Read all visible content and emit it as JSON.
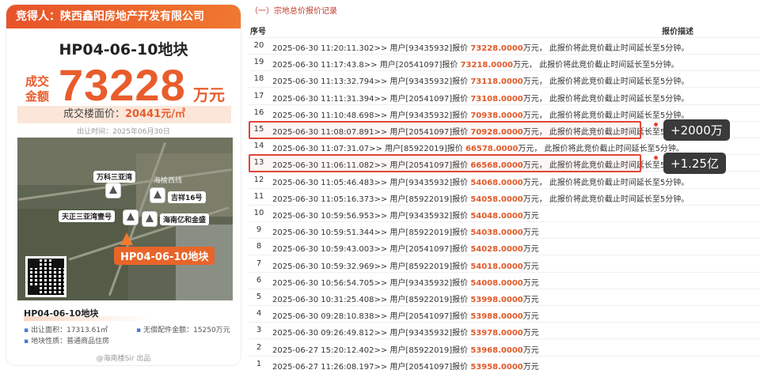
{
  "card": {
    "bidder": "竞得人：陕西鑫阳房地产开发有限公司",
    "plot_title": "HP04-06-10地块",
    "deal_label": "成交金额",
    "deal_amount": "73228",
    "deal_unit": "万元",
    "floor_price_label": "成交楼面价：",
    "floor_price_value": "20441元/㎡",
    "sale_time": "出让时间：2025年06月30日",
    "map": {
      "labels": [
        "万科三亚湾",
        "吉祥16号",
        "天正三亚湾壹号",
        "海南亿和金盛",
        "海榆西线"
      ],
      "plot_label": "HP04-06-10地块"
    },
    "info": {
      "title": "HP04-06-10地块",
      "area": "出让面积：17313.61㎡",
      "fee": "无偿配件金额：15250万元",
      "nature": "地块性质：普通商品住房"
    },
    "publisher": "@海南楼Sir 出品"
  },
  "records": {
    "section_title": "（一）宗地总价报价记录",
    "headers": {
      "no": "序号",
      "desc": "报价描述"
    },
    "rows": [
      {
        "no": "20",
        "time": "2025-06-30 11:20:11.302>>",
        "user": "用户[93435932]报价",
        "amount": "73228.0000",
        "suffix": "万元， 此报价将此竞价截止时间延长至5分钟。"
      },
      {
        "no": "19",
        "time": "2025-06-30 11:17:43.8>>",
        "user": "用户[20541097]报价",
        "amount": "73218.0000",
        "suffix": "万元， 此报价将此竞价截止时间延长至5分钟。"
      },
      {
        "no": "18",
        "time": "2025-06-30 11:13:32.794>>",
        "user": "用户[93435932]报价",
        "amount": "73118.0000",
        "suffix": "万元， 此报价将此竞价截止时间延长至5分钟。"
      },
      {
        "no": "17",
        "time": "2025-06-30 11:11:31.394>>",
        "user": "用户[20541097]报价",
        "amount": "73108.0000",
        "suffix": "万元， 此报价将此竞价截止时间延长至5分钟。"
      },
      {
        "no": "16",
        "time": "2025-06-30 11:10:48.698>>",
        "user": "用户[93435932]报价",
        "amount": "70938.0000",
        "suffix": "万元， 此报价将此竞价截止时间延长至5分钟。"
      },
      {
        "no": "15",
        "time": "2025-06-30 11:08:07.891>>",
        "user": "用户[20541097]报价",
        "amount": "70928.0000",
        "suffix": "万元， 此报价将此竞价截止时间延长至5分钟。"
      },
      {
        "no": "14",
        "time": "2025-06-30 11:07:31.07>>",
        "user": "用户[85922019]报价",
        "amount": "66578.0000",
        "suffix": "万元， 此报价将此竞价截止时间延长至5分钟。"
      },
      {
        "no": "13",
        "time": "2025-06-30 11:06:11.082>>",
        "user": "用户[20541097]报价",
        "amount": "66568.0000",
        "suffix": "万元， 此报价将此竞价截止时间延长至5分钟。"
      },
      {
        "no": "12",
        "time": "2025-06-30 11:05:46.483>>",
        "user": "用户[93435932]报价",
        "amount": "54068.0000",
        "suffix": "万元， 此报价将此竞价截止时间延长至5分钟。"
      },
      {
        "no": "11",
        "time": "2025-06-30 11:05:16.373>>",
        "user": "用户[85922019]报价",
        "amount": "54058.0000",
        "suffix": "万元， 此报价将此竞价截止时间延长至5分钟。"
      },
      {
        "no": "10",
        "time": "2025-06-30 10:59:56.953>>",
        "user": "用户[93435932]报价",
        "amount": "54048.0000",
        "suffix": "万元"
      },
      {
        "no": "9",
        "time": "2025-06-30 10:59:51.344>>",
        "user": "用户[85922019]报价",
        "amount": "54038.0000",
        "suffix": "万元"
      },
      {
        "no": "8",
        "time": "2025-06-30 10:59:43.003>>",
        "user": "用户[20541097]报价",
        "amount": "54028.0000",
        "suffix": "万元"
      },
      {
        "no": "7",
        "time": "2025-06-30 10:59:32.969>>",
        "user": "用户[85922019]报价",
        "amount": "54018.0000",
        "suffix": "万元"
      },
      {
        "no": "6",
        "time": "2025-06-30 10:56:54.705>>",
        "user": "用户[93435932]报价",
        "amount": "54008.0000",
        "suffix": "万元"
      },
      {
        "no": "5",
        "time": "2025-06-30 10:31:25.408>>",
        "user": "用户[85922019]报价",
        "amount": "53998.0000",
        "suffix": "万元"
      },
      {
        "no": "4",
        "time": "2025-06-30 09:28:10.838>>",
        "user": "用户[20541097]报价",
        "amount": "53988.0000",
        "suffix": "万元"
      },
      {
        "no": "3",
        "time": "2025-06-30 09:26:49.812>>",
        "user": "用户[93435932]报价",
        "amount": "53978.0000",
        "suffix": "万元"
      },
      {
        "no": "2",
        "time": "2025-06-27 15:20:12.402>>",
        "user": "用户[85922019]报价",
        "amount": "53968.0000",
        "suffix": "万元"
      },
      {
        "no": "1",
        "time": "2025-06-27 11:26:08.197>>",
        "user": "用户[20541097]报价",
        "amount": "53958.0000",
        "suffix": "万元"
      }
    ],
    "annotations": [
      {
        "row_no": "15",
        "tag": "+2000万"
      },
      {
        "row_no": "13",
        "tag": "+1.25亿"
      }
    ]
  },
  "colors": {
    "accent": "#e85d2c",
    "highlight": "#e0453a",
    "tag_bg": "#3a3a3a"
  }
}
